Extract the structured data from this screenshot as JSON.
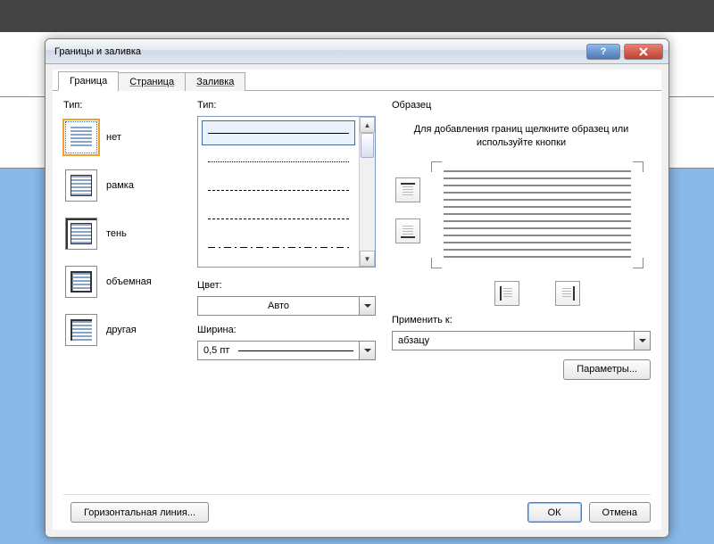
{
  "window": {
    "title": "Границы и заливка"
  },
  "tabs": [
    {
      "label": "Граница",
      "active": true
    },
    {
      "label": "Страница",
      "active": false
    },
    {
      "label": "Заливка",
      "active": false
    }
  ],
  "leftPanel": {
    "heading": "Тип:",
    "settings": [
      {
        "label": "нет",
        "selected": true,
        "kind": "none"
      },
      {
        "label": "рамка",
        "selected": false,
        "kind": "ramka"
      },
      {
        "label": "тень",
        "selected": false,
        "kind": "ten"
      },
      {
        "label": "объемная",
        "selected": false,
        "kind": "obj"
      },
      {
        "label": "другая",
        "selected": false,
        "kind": "drugaya"
      }
    ]
  },
  "stylePanel": {
    "heading": "Тип:",
    "colorLabel": "Цвет:",
    "colorValue": "Авто",
    "widthLabel": "Ширина:",
    "widthValue": "0,5 пт"
  },
  "preview": {
    "heading": "Образец",
    "hint": "Для добавления границ щелкните образец или используйте кнопки",
    "applyLabel": "Применить к:",
    "applyValue": "абзацу",
    "paramsButton": "Параметры..."
  },
  "footer": {
    "hline": "Горизонтальная линия...",
    "ok": "ОК",
    "cancel": "Отмена"
  }
}
